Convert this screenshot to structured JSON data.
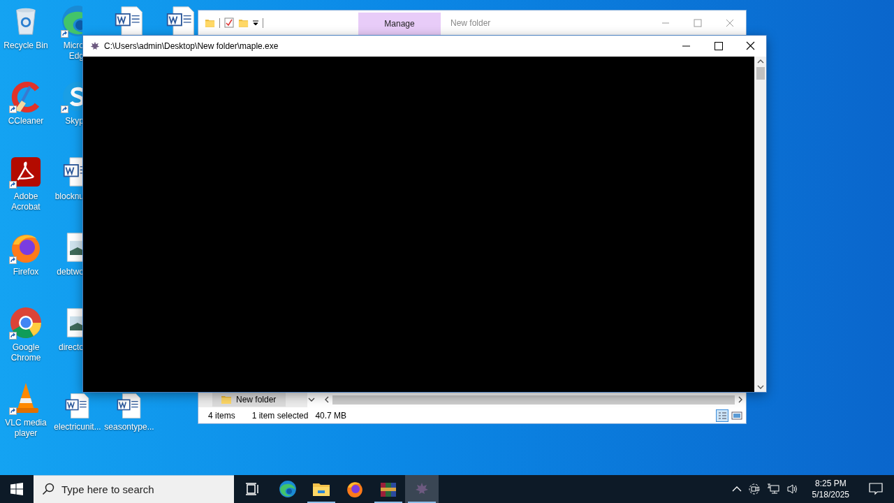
{
  "desktop_icons": [
    {
      "kind": "recycle",
      "label": "Recycle Bin",
      "shortcut": false
    },
    {
      "kind": "cleaner",
      "label": "CCleaner",
      "shortcut": true
    },
    {
      "kind": "pdf",
      "label": "Adobe Acrobat",
      "shortcut": true
    },
    {
      "kind": "firefox",
      "label": "Firefox",
      "shortcut": true
    },
    {
      "kind": "chrome",
      "label": "Google Chrome",
      "shortcut": true
    },
    {
      "kind": "vlc",
      "label": "VLC media player",
      "shortcut": true
    },
    {
      "kind": "edge",
      "label": "Micro Edg",
      "shortcut": true
    },
    {
      "kind": "chat",
      "label": "Skyp",
      "shortcut": true
    },
    {
      "kind": "word",
      "label": "blocknu",
      "shortcut": false
    },
    {
      "kind": "image",
      "label": "debtwo",
      "shortcut": false
    },
    {
      "kind": "image",
      "label": "directo",
      "shortcut": false
    },
    {
      "kind": "word",
      "label": "electricunit...",
      "shortcut": false
    },
    {
      "kind": "word",
      "shortcut": false
    },
    {
      "kind": "word",
      "label": "seasontype...",
      "shortcut": false
    },
    {
      "kind": "word",
      "shortcut": false
    }
  ],
  "explorer_window": {
    "ribbon_tab": "Manage",
    "title": "New folder",
    "nav_item": "New folder",
    "status": {
      "item_count": "4 items",
      "selection": "1 item selected",
      "size": "40.7 MB"
    }
  },
  "console_window": {
    "title": "C:\\Users\\admin\\Desktop\\New folder\\maple.exe"
  },
  "taskbar": {
    "search": {
      "placeholder": "Type here to search"
    },
    "apps": [
      {
        "kind": "task-view",
        "running": false,
        "selected": false
      },
      {
        "kind": "edge",
        "running": false,
        "selected": false
      },
      {
        "kind": "explorer",
        "running": true,
        "selected": false
      },
      {
        "kind": "firefox",
        "running": false,
        "selected": false
      },
      {
        "kind": "winrar",
        "running": true,
        "selected": false
      },
      {
        "kind": "maple",
        "running": true,
        "selected": true
      }
    ],
    "clock": {
      "time": "8:25 PM",
      "date": "5/18/2025"
    }
  }
}
